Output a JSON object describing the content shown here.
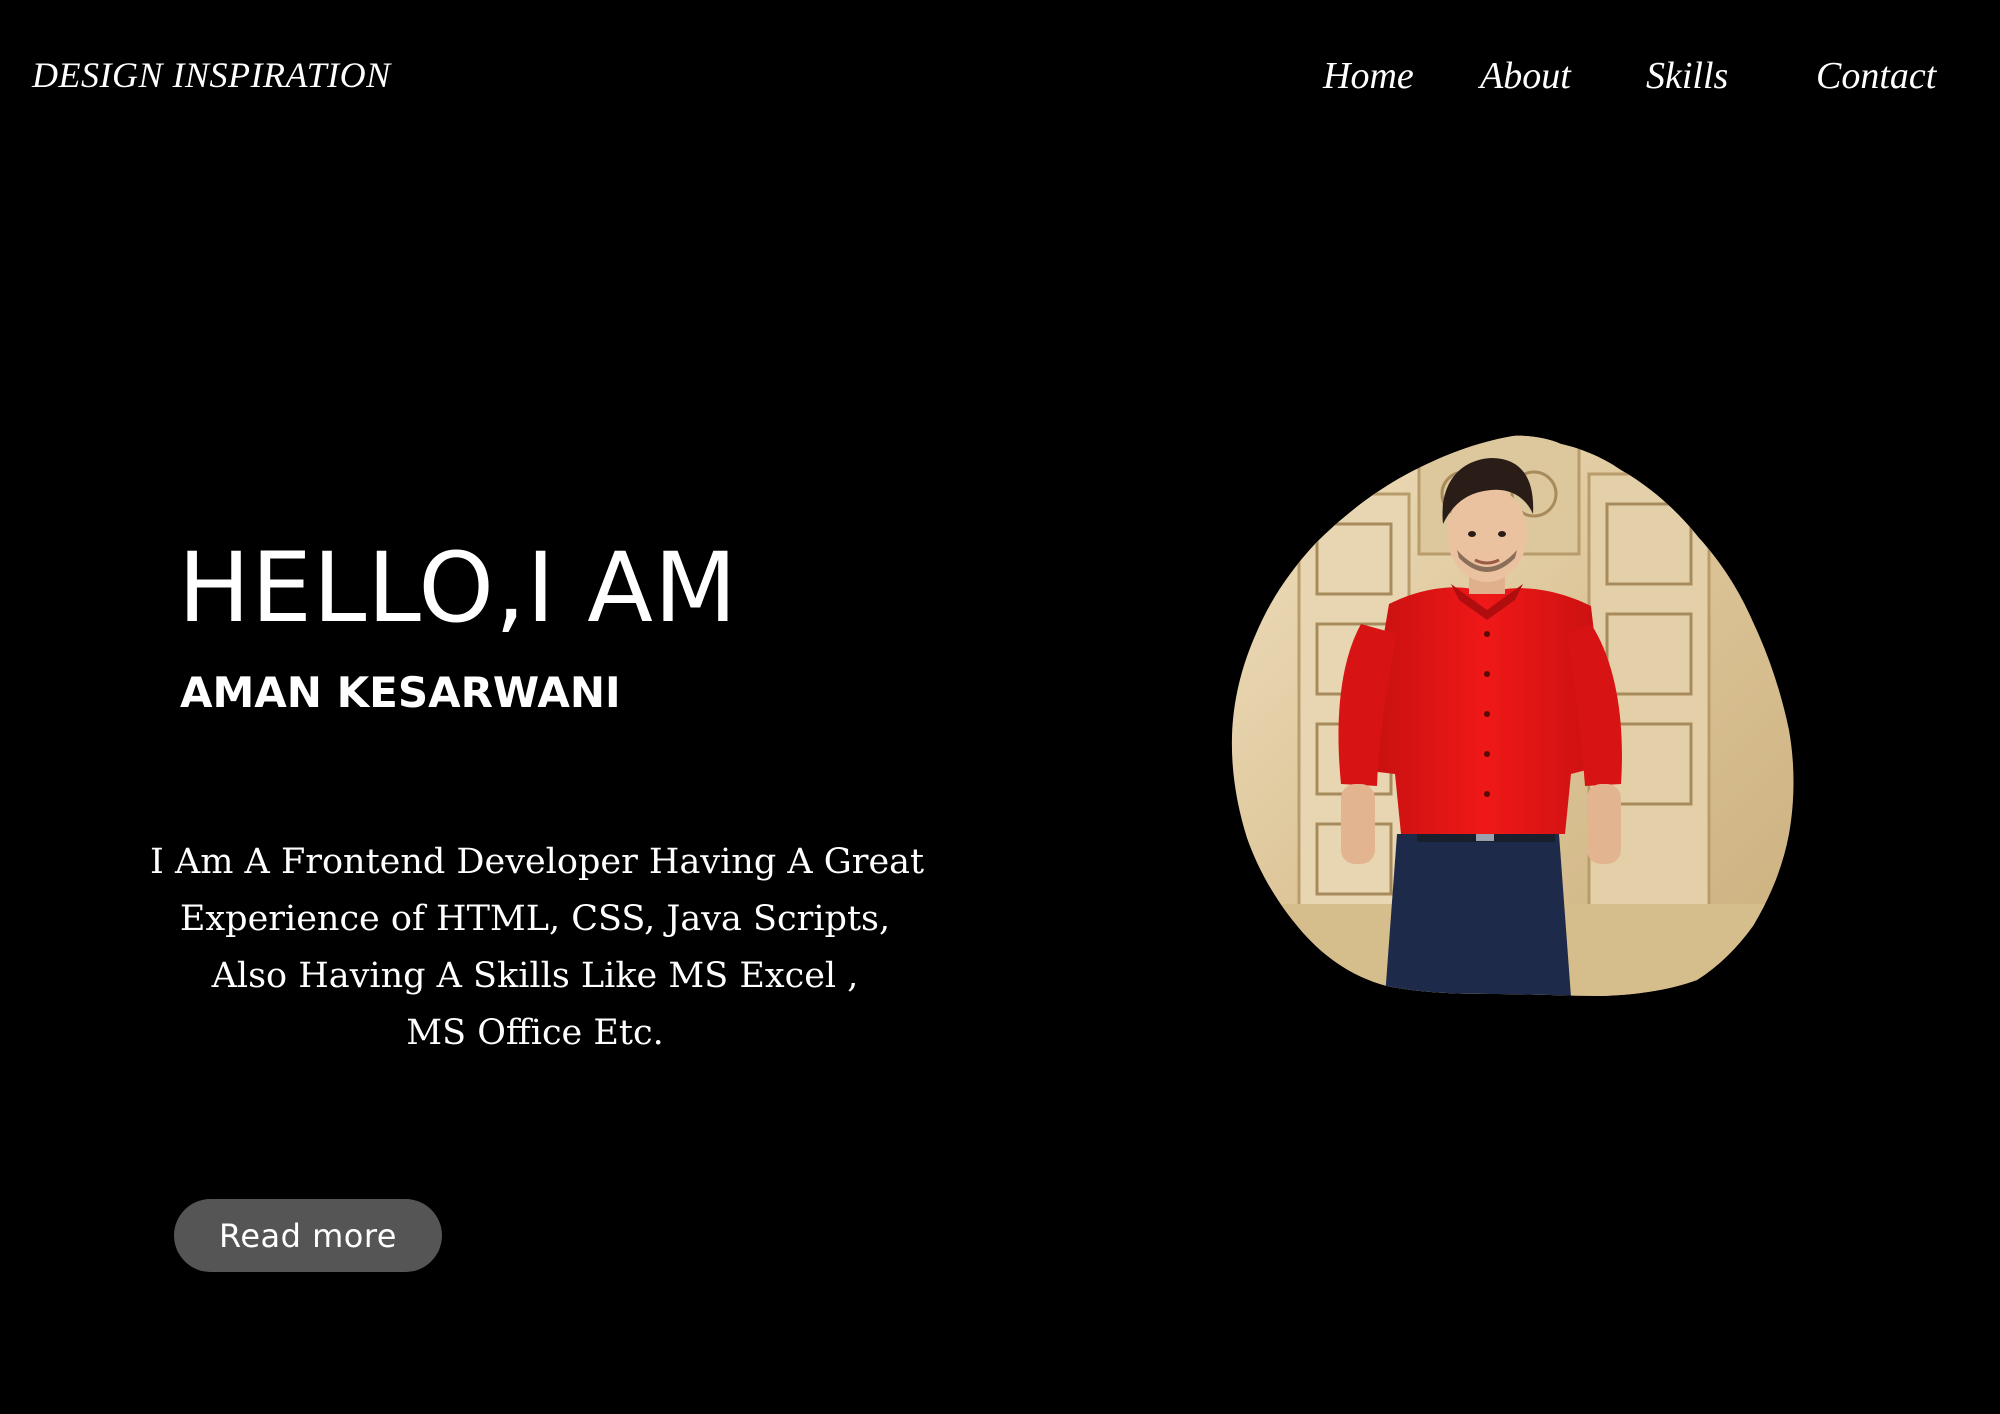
{
  "header": {
    "brand": "DESIGN INSPIRATION",
    "nav": [
      "Home",
      "About",
      "Skills",
      "Contact"
    ]
  },
  "hero": {
    "title": "HELLO,I AM",
    "name": "AMAN KESARWANI",
    "description_lines": [
      "I Am A Frontend Developer Having A Great",
      "Experience of HTML, CSS, Java Scripts,",
      "Also Having A Skills Like MS Excel ,",
      "MS Office Etc."
    ],
    "button_label": "Read more"
  },
  "colors": {
    "background": "#000000",
    "text": "#ffffff",
    "button": "#555555",
    "shirt": "#e01414",
    "trousers": "#1e2a4a",
    "stone": "#e6d2aa"
  },
  "profile_photo": {
    "icon": "profile-photo"
  }
}
